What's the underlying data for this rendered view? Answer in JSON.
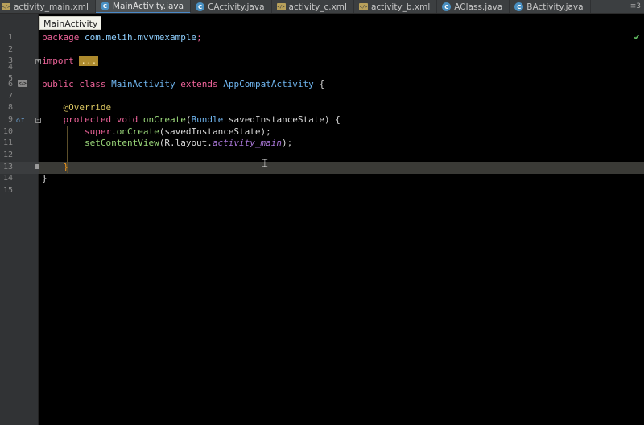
{
  "tabs": [
    {
      "label": "activity_main.xml",
      "icon": "xml-file-icon",
      "active": false
    },
    {
      "label": "MainActivity.java",
      "icon": "java-class-icon",
      "active": true
    },
    {
      "label": "CActivity.java",
      "icon": "java-class-icon",
      "active": false
    },
    {
      "label": "activity_c.xml",
      "icon": "xml-file-icon",
      "active": false
    },
    {
      "label": "activity_b.xml",
      "icon": "xml-file-icon",
      "active": false
    },
    {
      "label": "AClass.java",
      "icon": "java-class-icon",
      "active": false
    },
    {
      "label": "BActivity.java",
      "icon": "java-class-icon",
      "active": false
    }
  ],
  "tab_overflow": "≡3",
  "breadcrumb": "MainActivity",
  "code": {
    "l1": {
      "kw": "package",
      "pkg": "com.melih.mvvmexample",
      "semi": ";"
    },
    "l3": {
      "kw": "import",
      "fold": "..."
    },
    "l6": {
      "kw1": "public",
      "kw2": "class",
      "name": "MainActivity",
      "kw3": "extends",
      "parent": "AppCompatActivity",
      "brace": "{"
    },
    "l8": {
      "ann": "@Override"
    },
    "l9": {
      "kw1": "protected",
      "kw2": "void",
      "fn": "onCreate",
      "p1": "(",
      "type": "Bundle",
      "arg": " savedInstanceState) {"
    },
    "l10": {
      "kw": "super",
      "dot": ".",
      "fn": "onCreate",
      "rest": "(savedInstanceState);"
    },
    "l11": {
      "fn": "setContentView",
      "p1": "(R.layout.",
      "fld": "activity_main",
      "rest": ");"
    },
    "l13": {
      "brace": "}"
    },
    "l14": {
      "brace": "}"
    }
  },
  "line_numbers": [
    "1",
    "2",
    "3",
    "4",
    "5",
    "6",
    "7",
    "8",
    "9",
    "10",
    "11",
    "12",
    "13",
    "14",
    "15"
  ]
}
